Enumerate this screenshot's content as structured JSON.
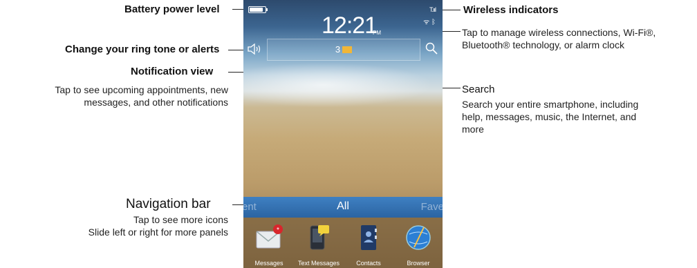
{
  "callouts": {
    "battery": {
      "title": "Battery power level"
    },
    "ring": {
      "title": "Change your ring tone or alerts"
    },
    "notification": {
      "title": "Notification view",
      "line1": "Tap to see upcoming appointments, new",
      "line2": "messages, and other notifications"
    },
    "navigation": {
      "title": "Navigation bar",
      "line1": "Tap to see more icons",
      "line2": "Slide left or right for more panels"
    },
    "wireless": {
      "title": "Wireless indicators",
      "line1": "Tap to manage wireless connections, Wi-Fi®,",
      "line2": "Bluetooth® technology, or alarm clock"
    },
    "search": {
      "title": "Search",
      "line1": "Search your entire smartphone, including",
      "line2": "help, messages, music, the Internet, and",
      "line3": "more"
    }
  },
  "phone": {
    "time": "12:21",
    "ampm": "PM",
    "signal": "T.ııl",
    "wireless_glyph": "ᯤ ᛒ",
    "notification_count": "3",
    "navbar": {
      "left": "ent",
      "center": "All",
      "right": "Fave"
    },
    "apps": [
      {
        "label": "Messages"
      },
      {
        "label": "Text Messages"
      },
      {
        "label": "Contacts"
      },
      {
        "label": "Browser"
      }
    ]
  }
}
